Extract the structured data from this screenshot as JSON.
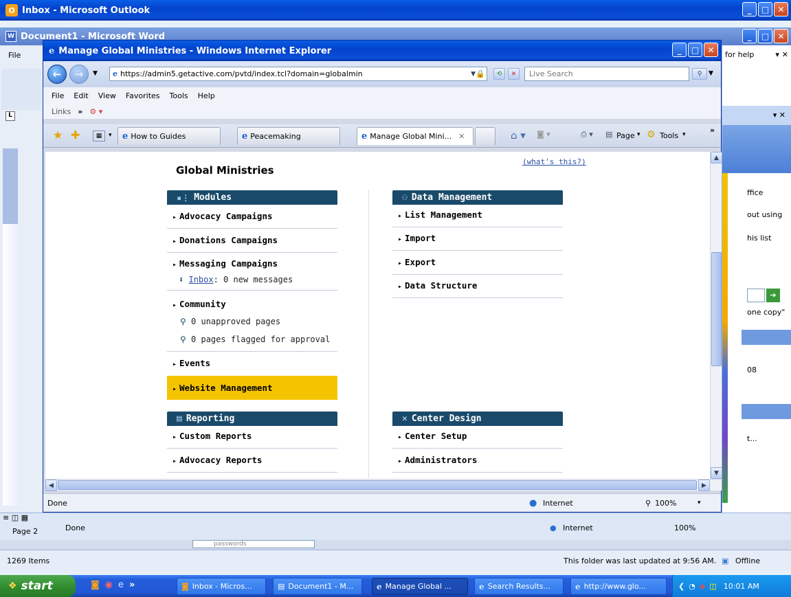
{
  "outlook": {
    "title": "Inbox - Microsoft Outlook",
    "items_count": "1269 Items",
    "folder_status": "This folder was last updated at 9:56 AM.",
    "offline": "Offline",
    "search_field": "passwords",
    "side_texts": [
      "ffice",
      "out using",
      "his list",
      "one copy\"",
      "08",
      "t..."
    ]
  },
  "word": {
    "title": "Document1 - Microsoft Word",
    "menu_file": "File",
    "help_box": "for help",
    "page_label": "Page 2",
    "status_done": "Done",
    "status_zone": "Internet",
    "status_zoom": "100%"
  },
  "ie": {
    "title": "Manage Global Ministries - Windows Internet Explorer",
    "url": "https://admin5.getactive.com/pvtd/index.tcl?domain=globalmin",
    "search_placeholder": "Live Search",
    "menu": [
      "File",
      "Edit",
      "View",
      "Favorites",
      "Tools",
      "Help"
    ],
    "links_label": "Links",
    "tabs": [
      "How to Guides",
      "Peacemaking",
      "Manage Global Mini..."
    ],
    "cmd_page": "Page",
    "cmd_tools": "Tools",
    "status_done": "Done",
    "status_zone": "Internet",
    "status_zoom": "100%"
  },
  "page": {
    "heading": "Global Ministries",
    "whats_this": "(what's this?)",
    "modules": {
      "header": "Modules",
      "items": [
        "Advocacy Campaigns",
        "Donations Campaigns",
        "Messaging Campaigns"
      ],
      "inbox_link": "Inbox",
      "inbox_text": ": 0 new messages",
      "community": "Community",
      "unapproved": "0 unapproved pages",
      "flagged": "0 pages flagged for approval",
      "events": "Events",
      "website": "Website Management"
    },
    "data_management": {
      "header": "Data Management",
      "items": [
        "List Management",
        "Import",
        "Export",
        "Data Structure"
      ]
    },
    "reporting": {
      "header": "Reporting",
      "items": [
        "Custom Reports",
        "Advocacy Reports"
      ]
    },
    "center_design": {
      "header": "Center Design",
      "items": [
        "Center Setup",
        "Administrators"
      ]
    }
  },
  "taskbar": {
    "start": "start",
    "buttons": [
      "Inbox - Micros...",
      "Document1 - M...",
      "Manage Global ...",
      "Search Results...",
      "http://www.glo..."
    ],
    "clock": "10:01 AM"
  },
  "colors": {
    "header_bg": "#1a4a6a",
    "highlight": "#f5c400",
    "xp_blue": "#0343cc"
  }
}
